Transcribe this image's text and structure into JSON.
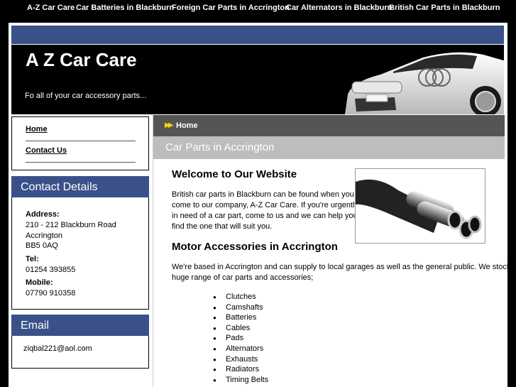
{
  "top_nav": [
    "A-Z Car Care",
    "Car Batteries in Blackburn",
    "Foreign Car Parts in Accrington",
    "Car Alternators in Blackburn",
    "British Car Parts in Blackburn"
  ],
  "banner": {
    "title": "A Z Car Care",
    "tagline": "Fo all of your car accessory parts..."
  },
  "menu": [
    "Home",
    "Contact Us"
  ],
  "contact": {
    "heading": "Contact Details",
    "address_label": "Address:",
    "address_lines": [
      "210 - 212 Blackburn Road",
      "Accrington",
      "BB5 0AQ"
    ],
    "tel_label": "Tel:",
    "tel": "01254 393855",
    "mobile_label": "Mobile:",
    "mobile": "07790 910358"
  },
  "email": {
    "heading": "Email",
    "address": "ziqbal221@aol.com"
  },
  "breadcrumb": "Home",
  "page_heading": "Car Parts in Accrington",
  "welcome": {
    "heading": "Welcome to Our Website",
    "lines": [
      "British car parts in Blackburn can be found when you",
      "come to our company, A-Z Car Care. If you're urgently",
      "in need of a car part, come to us and we can help you",
      "find the one that will suit you."
    ]
  },
  "motor": {
    "heading": "Motor Accessories in Accrington",
    "lines": [
      "We're based in Accrington and can supply to local garages as well as the general public. We stock a",
      "huge range of car parts and accessories;"
    ],
    "items": [
      "Clutches",
      "Camshafts",
      "Batteries",
      "Cables",
      "Pads",
      "Alternators",
      "Exhausts",
      "Radiators",
      "Timing Belts"
    ]
  },
  "colors": {
    "header_blue": "#3a5089",
    "breadcrumb_gray": "#555555",
    "subhead_gray": "#bdbdbd"
  }
}
